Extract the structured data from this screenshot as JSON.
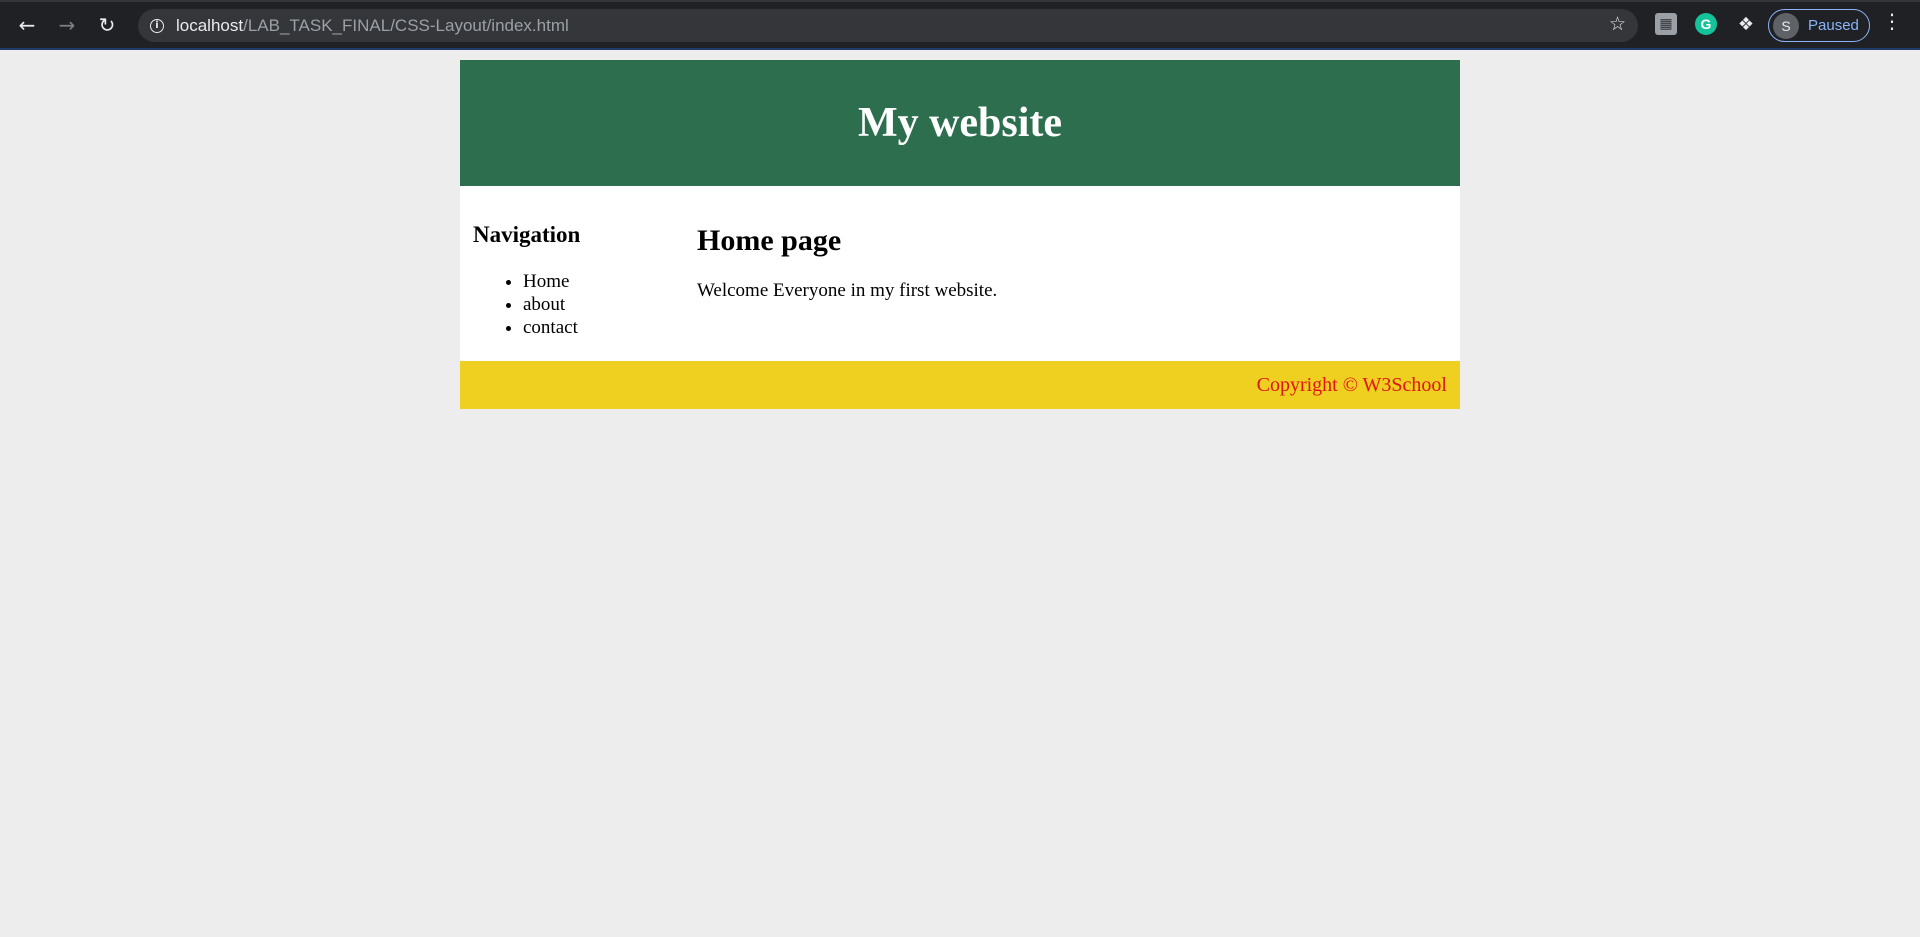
{
  "browser": {
    "url_host": "localhost",
    "url_path": "/LAB_TASK_FINAL/CSS-Layout/index.html",
    "icons": {
      "back": "arrow-left-icon",
      "forward": "arrow-right-icon",
      "reload": "reload-icon",
      "site_info": "info-icon",
      "bookmark": "star-icon",
      "extension_1": "document-extension-icon",
      "extension_2": "grammarly-icon",
      "extensions": "puzzle-icon",
      "menu": "kebab-menu-icon"
    },
    "grammarly_letter": "G",
    "profile": {
      "initial": "S",
      "status": "Paused"
    }
  },
  "site": {
    "title": "My website",
    "nav_heading": "Navigation",
    "nav_items": [
      "Home",
      "about",
      "contact"
    ],
    "page_heading": "Home page",
    "body_text": "Welcome Everyone in my first website.",
    "footer_text": "Copyright © W3School"
  },
  "colors": {
    "header_bg": "#2d6e4e",
    "footer_bg": "#efcf1f",
    "footer_text": "#e01414",
    "page_bg": "#ededed"
  }
}
